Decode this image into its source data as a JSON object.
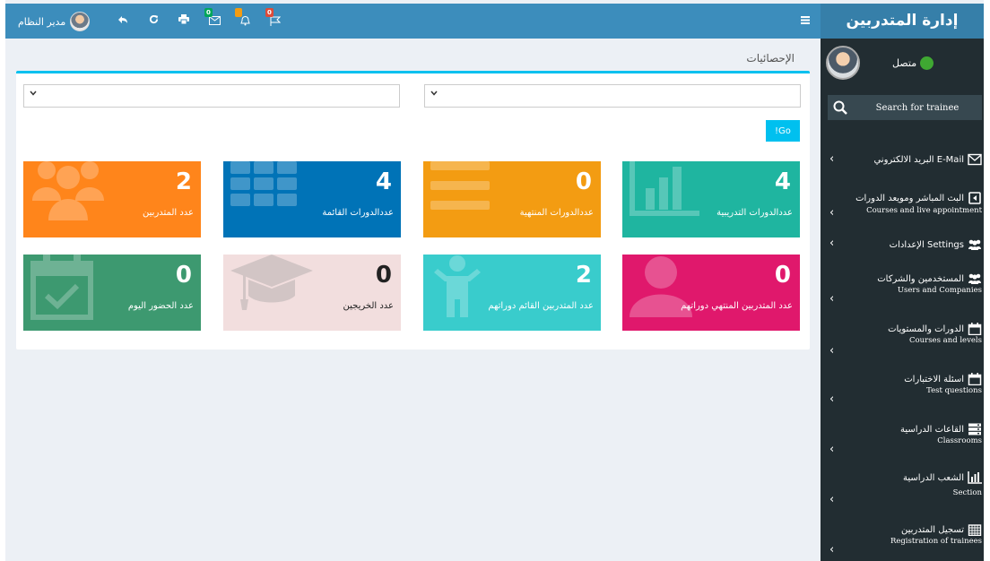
{
  "header": {
    "brand": "إدارة المتدربين",
    "user_name": "مدير النظام",
    "toolbar_icons": [
      {
        "name": "reply-icon",
        "glyph": "↰"
      },
      {
        "name": "refresh-icon",
        "glyph": "↻"
      },
      {
        "name": "print-icon",
        "glyph": "⎙"
      },
      {
        "name": "messages-icon",
        "glyph": "✉",
        "badge": "0",
        "badge_color": "#00a65a"
      },
      {
        "name": "notifications-icon",
        "glyph": "🔔",
        "badge": "",
        "badge_color": "#f39c12"
      },
      {
        "name": "flag-icon",
        "glyph": "⚑",
        "badge": "0",
        "badge_color": "#dd4b39"
      }
    ]
  },
  "sidebar": {
    "status": "متصل",
    "search_placeholder": "Search for trainee",
    "items": [
      {
        "ar": "البريد الالكتروني E-Mail",
        "en": "",
        "icon": "envelope-icon"
      },
      {
        "ar": "البث المباشر ومويعد الدورات",
        "en": "Courses and live appointment",
        "icon": "live-broadcast-icon"
      },
      {
        "ar": "الإعدادات Settings",
        "en": "",
        "icon": "settings-users-icon"
      },
      {
        "ar": "المستخدمين والشركات",
        "en": "Users and Companies",
        "icon": "users-icon"
      },
      {
        "ar": "الدورات والمستويات",
        "en": "Courses and levels",
        "icon": "calendar-icon"
      },
      {
        "ar": "اسئلة الاختبارات",
        "en": "Test questions",
        "icon": "calendar-icon"
      },
      {
        "ar": "القاعات الدراسية",
        "en": "Classrooms",
        "icon": "server-icon"
      },
      {
        "ar": "الشعب الدراسية",
        "en": "Section",
        "icon": "bar-chart-icon"
      },
      {
        "ar": "تسجيل المتدربين",
        "en": "Registration of trainees",
        "icon": "calendar-grid-icon"
      }
    ]
  },
  "content": {
    "title": "الإحصائيات",
    "go_button": "!Go",
    "tiles": [
      {
        "value": "4",
        "label": "عددالدورات التدريبية",
        "color": "#1fb5a0"
      },
      {
        "value": "0",
        "label": "عددالدورات المنتهية",
        "color": "#f39c12"
      },
      {
        "value": "4",
        "label": "عددالدورات القائمة",
        "color": "#0073b7"
      },
      {
        "value": "2",
        "label": "عدد المتدربين",
        "color": "#ff851b"
      },
      {
        "value": "0",
        "label": "عدد المتدربين المنتهي دوراتهم",
        "color": "#e0186c"
      },
      {
        "value": "2",
        "label": "عدد المتدربين القائم دوراتهم",
        "color": "#39cccc"
      },
      {
        "value": "0",
        "label": "عدد الخريجين",
        "color": "#f2dede"
      },
      {
        "value": "0",
        "label": "عدد الحضور اليوم",
        "color": "#3d9970"
      }
    ]
  }
}
